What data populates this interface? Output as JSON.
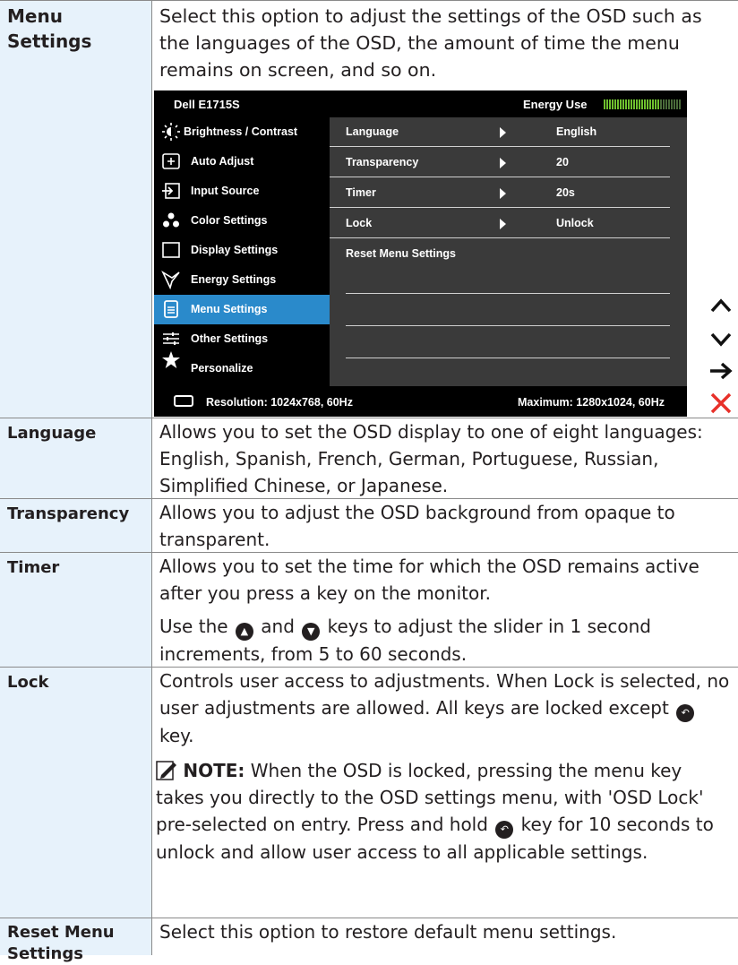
{
  "rows": [
    {
      "label": "Menu Settings",
      "desc": "Select this option to adjust the settings of the OSD such as the languages of the OSD, the amount of time the menu remains on screen, and so on."
    },
    {
      "label": "Language",
      "desc": "Allows you to set the OSD display to one of eight languages: English, Spanish, French, German, Portuguese, Russian, Simplified Chinese, or Japanese."
    },
    {
      "label": "Transparency",
      "desc": "Allows you to adjust the OSD background from opaque to transparent."
    },
    {
      "label": "Timer",
      "desc": "Allows you to set the time for which the OSD remains active after you press a key on the monitor.",
      "desc2_a": "Use the",
      "desc2_b": "and",
      "desc2_c": "keys to adjust the slider in 1 second increments, from 5 to 60 seconds."
    },
    {
      "label": "Lock",
      "desc_a": "Controls user access to adjustments. When Lock is selected, no user adjustments are allowed. All keys are locked except",
      "desc_b": "key.",
      "note_label": "NOTE:",
      "note_a": "When the OSD is locked, pressing the menu key takes you directly to the OSD settings menu, with 'OSD Lock' pre-selected on entry. Press and hold",
      "note_b": "key for 10 seconds to unlock and allow user access to all applicable settings."
    },
    {
      "label_line1": "Reset Menu",
      "label_line2": "Settings",
      "desc": "Select this option to restore default menu settings."
    }
  ],
  "osd": {
    "model": "Dell E1715S",
    "energy_label": "Energy Use",
    "energy_level": 0.72,
    "menu": [
      {
        "label": "Brightness / Contrast",
        "icon": "brightness-icon"
      },
      {
        "label": "Auto Adjust",
        "icon": "auto-adjust-icon"
      },
      {
        "label": "Input Source",
        "icon": "input-source-icon"
      },
      {
        "label": "Color Settings",
        "icon": "color-settings-icon"
      },
      {
        "label": "Display Settings",
        "icon": "display-settings-icon"
      },
      {
        "label": "Energy Settings",
        "icon": "energy-settings-icon"
      },
      {
        "label": "Menu Settings",
        "icon": "menu-settings-icon",
        "active": true
      },
      {
        "label": "Other Settings",
        "icon": "other-settings-icon"
      },
      {
        "label": "Personalize",
        "icon": "star-icon"
      }
    ],
    "options": [
      {
        "name": "Language",
        "value": "English"
      },
      {
        "name": "Transparency",
        "value": "20"
      },
      {
        "name": "Timer",
        "value": "20s"
      },
      {
        "name": "Lock",
        "value": "Unlock"
      },
      {
        "name": "Reset Menu Settings",
        "value": ""
      }
    ],
    "resolution": "Resolution: 1024x768, 60Hz",
    "maximum": "Maximum: 1280x1024, 60Hz",
    "accent_color": "#2a8acb"
  },
  "side_keys": [
    "up-arrow-icon",
    "down-arrow-icon",
    "right-arrow-icon",
    "close-icon"
  ]
}
